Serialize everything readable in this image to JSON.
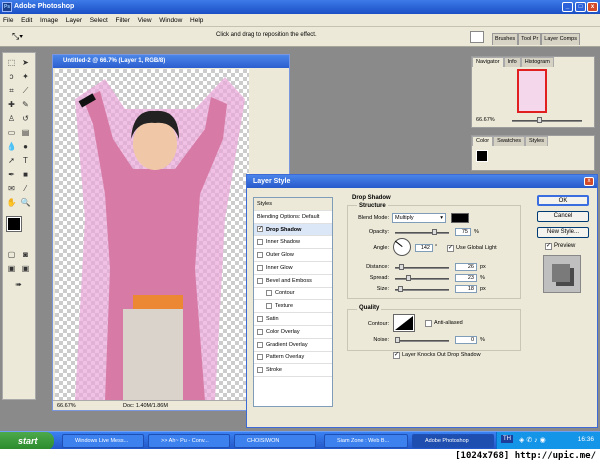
{
  "app": {
    "title": "Adobe Photoshop"
  },
  "menu": [
    "File",
    "Edit",
    "Image",
    "Layer",
    "Select",
    "Filter",
    "View",
    "Window",
    "Help"
  ],
  "options": {
    "hint": "Click and drag to reposition the effect."
  },
  "panel_tabs_top": [
    "Brushes",
    "Tool Pr",
    "Layer Comps"
  ],
  "document": {
    "title": "Untitled-2 @ 66.7% (Layer 1, RGB/8)",
    "zoom": "66.67%",
    "doc_info": "Doc: 1.40M/1.86M"
  },
  "navigator": {
    "tabs": [
      "Navigator",
      "Info",
      "Histogram"
    ],
    "zoom": "66.67%"
  },
  "color_panel": {
    "tabs": [
      "Color",
      "Swatches",
      "Styles"
    ]
  },
  "dialog": {
    "title": "Layer Style",
    "styles_header": "Styles",
    "blending": "Blending Options: Default",
    "styles": [
      {
        "label": "Drop Shadow",
        "checked": true,
        "selected": true
      },
      {
        "label": "Inner Shadow",
        "checked": false
      },
      {
        "label": "Outer Glow",
        "checked": false
      },
      {
        "label": "Inner Glow",
        "checked": false
      },
      {
        "label": "Bevel and Emboss",
        "checked": false
      },
      {
        "label": "Contour",
        "checked": false,
        "sub": true
      },
      {
        "label": "Texture",
        "checked": false,
        "sub": true
      },
      {
        "label": "Satin",
        "checked": false
      },
      {
        "label": "Color Overlay",
        "checked": false
      },
      {
        "label": "Gradient Overlay",
        "checked": false
      },
      {
        "label": "Pattern Overlay",
        "checked": false
      },
      {
        "label": "Stroke",
        "checked": false
      }
    ],
    "section": "Drop Shadow",
    "structure": "Structure",
    "blend_mode_label": "Blend Mode:",
    "blend_mode": "Multiply",
    "shadow_color": "#000000",
    "opacity_label": "Opacity:",
    "opacity": "75",
    "opacity_level": 0.75,
    "angle_label": "Angle:",
    "angle": "142",
    "angle_unit": "°",
    "global_light": "Use Global Light",
    "distance_label": "Distance:",
    "distance": "26",
    "distance_level": 0.09,
    "spread_label": "Spread:",
    "spread": "23",
    "spread_level": 0.23,
    "size_label": "Size:",
    "size": "18",
    "size_level": 0.07,
    "quality": "Quality",
    "contour_label": "Contour:",
    "anti_aliased": "Anti-aliased",
    "noise_label": "Noise:",
    "noise": "0",
    "noise_level": 0,
    "knockout": "Layer Knocks Out Drop Shadow",
    "pct": "%",
    "px": "px",
    "ok": "OK",
    "cancel": "Cancel",
    "new_style": "New Style...",
    "preview": "Preview"
  },
  "taskbar": {
    "start": "start",
    "tasks": [
      "Windows Live Mess...",
      ">> Ah~ Pu - Conv...",
      "CHOISIWON",
      "Siam Zone : Web B...",
      "Adobe Photoshop"
    ],
    "lang": "TH",
    "clock": "16:36"
  },
  "watermark": "[1024x768] http://upic.me/"
}
